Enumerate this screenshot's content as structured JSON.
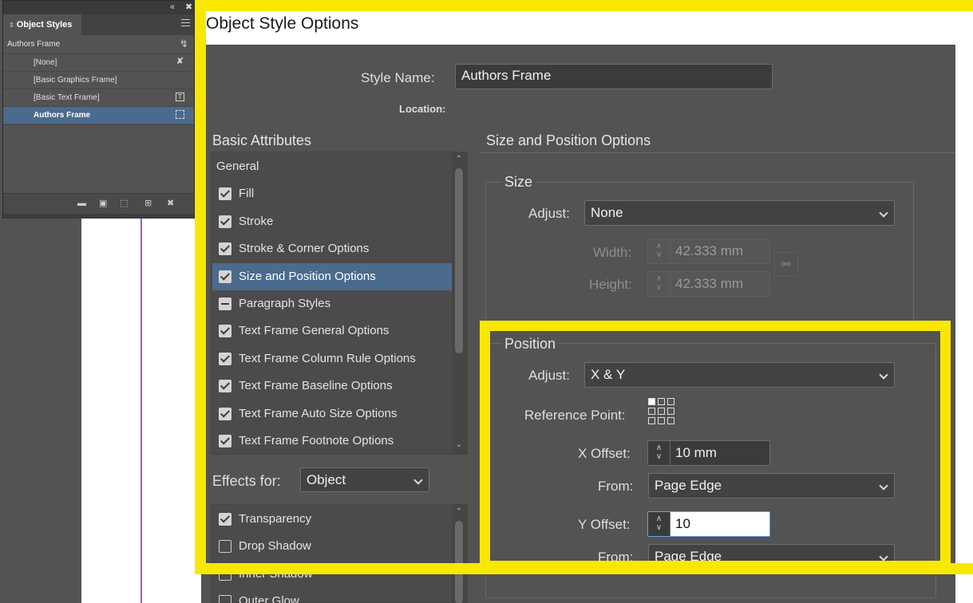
{
  "object_styles_panel": {
    "tab_title": "Object Styles",
    "current_style": "Authors Frame",
    "items": [
      {
        "label": "[None]",
        "icon": "eraser-icon",
        "glyph": "✘"
      },
      {
        "label": "[Basic Graphics Frame]",
        "icon": "",
        "glyph": ""
      },
      {
        "label": "[Basic Text Frame]",
        "icon": "text-frame-icon",
        "glyph": "T"
      },
      {
        "label": "Authors Frame",
        "icon": "frame-icon",
        "glyph": ""
      }
    ],
    "selected_index": 3,
    "topstrip_glyphs": {
      "collapse": "«",
      "close": "✖"
    },
    "footer_glyphs": {
      "folder": "▬",
      "style_override": "▣",
      "clear": "⬚",
      "new": "⊞",
      "delete": "✖"
    }
  },
  "dialog": {
    "title": "Object Style Options",
    "style_name_label": "Style Name:",
    "style_name_value": "Authors Frame",
    "location_label": "Location:",
    "basic_attributes_header": "Basic Attributes",
    "attributes": [
      {
        "label": "General",
        "state": "none"
      },
      {
        "label": "Fill",
        "state": "on"
      },
      {
        "label": "Stroke",
        "state": "on"
      },
      {
        "label": "Stroke & Corner Options",
        "state": "on"
      },
      {
        "label": "Size and Position Options",
        "state": "on"
      },
      {
        "label": "Paragraph Styles",
        "state": "mixed"
      },
      {
        "label": "Text Frame General Options",
        "state": "on"
      },
      {
        "label": "Text Frame Column Rule Options",
        "state": "on"
      },
      {
        "label": "Text Frame Baseline Options",
        "state": "on"
      },
      {
        "label": "Text Frame Auto Size Options",
        "state": "on"
      },
      {
        "label": "Text Frame Footnote Options",
        "state": "on"
      }
    ],
    "selected_attribute_index": 4,
    "effects_for_label": "Effects for:",
    "effects_for_value": "Object",
    "effects": [
      {
        "label": "Transparency",
        "state": "on"
      },
      {
        "label": "Drop Shadow",
        "state": "off"
      },
      {
        "label": "Inner Shadow",
        "state": "off"
      },
      {
        "label": "Outer Glow",
        "state": "off"
      }
    ],
    "section_header": "Size and Position Options",
    "size": {
      "group_label": "Size",
      "adjust_label": "Adjust:",
      "adjust_value": "None",
      "width_label": "Width:",
      "width_value": "42.333 mm",
      "height_label": "Height:",
      "height_value": "42.333 mm"
    },
    "position": {
      "group_label": "Position",
      "adjust_label": "Adjust:",
      "adjust_value": "X & Y",
      "reference_point_label": "Reference Point:",
      "reference_point_selected": "top-left",
      "x_offset_label": "X Offset:",
      "x_offset_value": "10 mm",
      "x_from_label": "From:",
      "x_from_value": "Page Edge",
      "y_offset_label": "Y Offset:",
      "y_offset_value": "10",
      "y_from_label": "From:",
      "y_from_value": "Page Edge"
    }
  },
  "colors": {
    "highlight": "#f8e800",
    "selection": "#4a6b8e",
    "dialog_bg": "#535353",
    "guide": "#b44be0"
  }
}
